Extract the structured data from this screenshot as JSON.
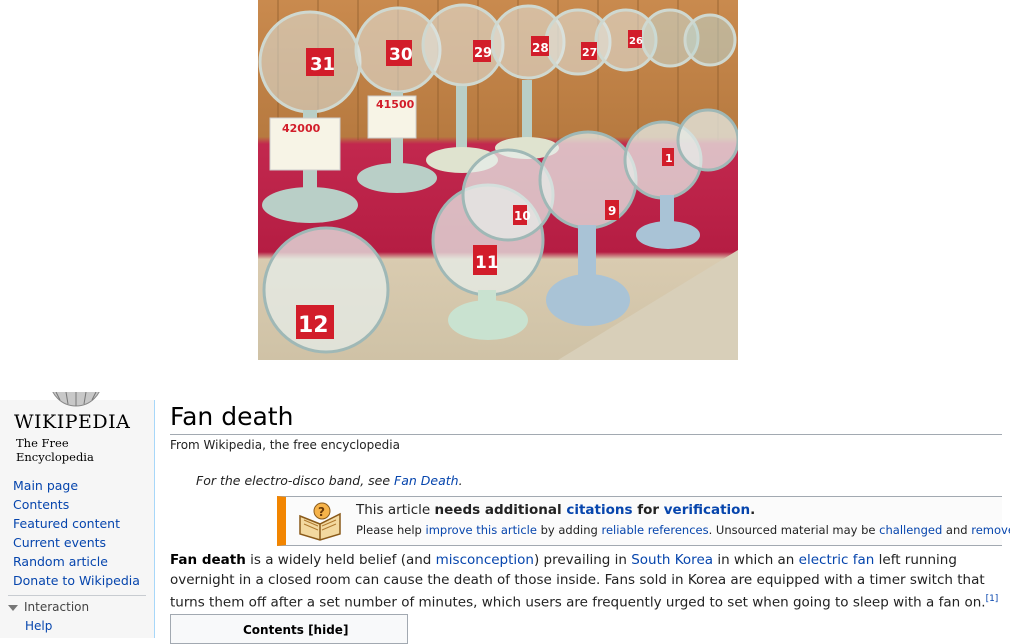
{
  "photo": {
    "alt_subject": "electric fans on display",
    "tags": [
      "31",
      "30",
      "29",
      "28",
      "27",
      "26",
      "12",
      "11",
      "10",
      "9",
      "1"
    ],
    "prices": [
      "42000",
      "41500"
    ]
  },
  "sidebar": {
    "logo_word": "WIKIPEDIA",
    "logo_tagline": "The Free Encyclopedia",
    "nav": [
      {
        "label": "Main page"
      },
      {
        "label": "Contents"
      },
      {
        "label": "Featured content"
      },
      {
        "label": "Current events"
      },
      {
        "label": "Random article"
      },
      {
        "label": "Donate to Wikipedia"
      }
    ],
    "interaction_label": "Interaction",
    "help_label": "Help"
  },
  "article": {
    "title": "Fan death",
    "site_sub": "From Wikipedia, the free encyclopedia",
    "hatnote_prefix": "For the electro-disco band, see ",
    "hatnote_link": "Fan Death",
    "hatnote_suffix": ".",
    "ambox": {
      "line1_a": "This article ",
      "line1_b": "needs additional ",
      "line1_link1": "citations",
      "line1_c": " for ",
      "line1_link2": "verification",
      "line1_d": ".",
      "line2_a": "Please help ",
      "line2_link1": "improve this article",
      "line2_b": " by adding ",
      "line2_link2": "reliable references",
      "line2_c": ". Unsourced material may be ",
      "line2_link3": "challenged",
      "line2_d": " and ",
      "line2_link4": "remove"
    },
    "para": {
      "bold": "Fan death",
      "t1": " is a widely held belief (and ",
      "l1": "misconception",
      "t2": ") prevailing in ",
      "l2": "South Korea",
      "t3": " in which an ",
      "l3": "electric fan",
      "t4": " left running overnight in a closed room can cause the death of those inside. Fans sold in Korea are equipped with a timer switch that turns them off after a set number of minutes, which users are frequently urged to set when going to sleep with a fan on.",
      "ref": "[1]"
    },
    "toc_title": "Contents [hide]"
  }
}
